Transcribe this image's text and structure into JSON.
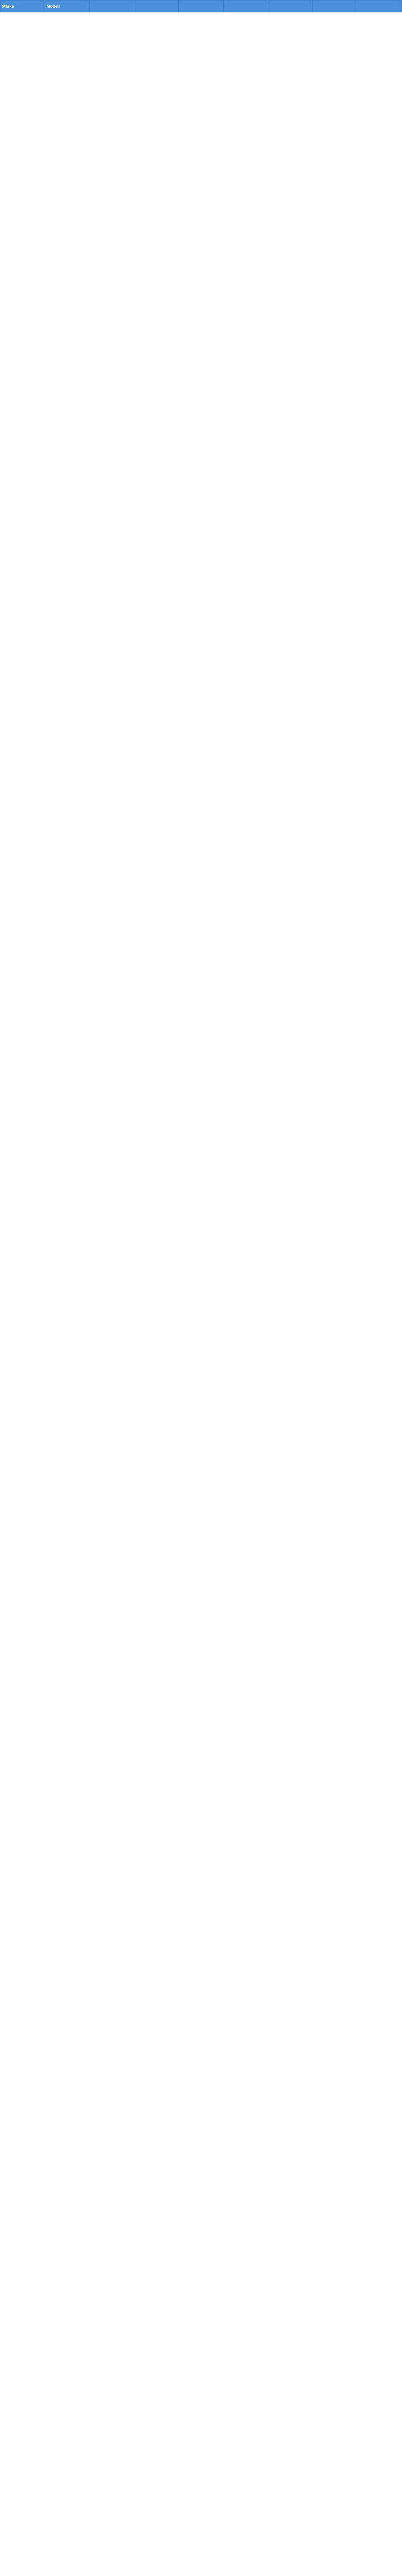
{
  "table": {
    "columns": [
      "Marke",
      "Modell",
      "",
      "",
      "",
      "",
      "",
      "",
      ""
    ],
    "rows": []
  },
  "colors": {
    "header_bg": "#4a90d9",
    "badge": "#3fae3f",
    "row_alt": "#f5f5f5"
  }
}
